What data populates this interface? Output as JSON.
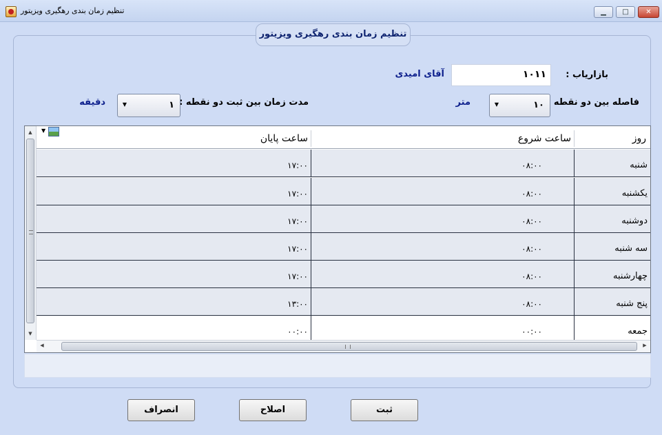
{
  "window": {
    "title": "تنظیم زمان بندی رهگیری ویزیتور",
    "minimize_glyph": "▁",
    "maximize_glyph": "□",
    "close_glyph": "✕"
  },
  "form": {
    "group_title": "تنظیم زمان بندی رهگیری ویزیتور",
    "marketer_label": "بازاریاب :",
    "marketer_code": "۱۰۱۱",
    "marketer_name": "آقای امیدی",
    "distance_label": "فاصله بین دو نقطه :",
    "distance_value": "۱۰",
    "distance_unit": "متر",
    "duration_label": "مدت زمان بین ثبت دو نقطه :",
    "duration_value": "۱",
    "duration_unit": "دقیقه"
  },
  "grid": {
    "columns": [
      "روز",
      "ساعت شروع",
      "ساعت پایان"
    ],
    "rows": [
      {
        "day": "شنبه",
        "start": "۰۸:۰۰",
        "end": "۱۷:۰۰"
      },
      {
        "day": "یکشنبه",
        "start": "۰۸:۰۰",
        "end": "۱۷:۰۰"
      },
      {
        "day": "دوشنبه",
        "start": "۰۸:۰۰",
        "end": "۱۷:۰۰"
      },
      {
        "day": "سه شنبه",
        "start": "۰۸:۰۰",
        "end": "۱۷:۰۰"
      },
      {
        "day": "چهارشنبه",
        "start": "۰۸:۰۰",
        "end": "۱۷:۰۰"
      },
      {
        "day": "پنج شنبه",
        "start": "۰۸:۰۰",
        "end": "۱۳:۰۰"
      },
      {
        "day": "جمعه",
        "start": "۰۰:۰۰",
        "end": "۰۰:۰۰"
      }
    ]
  },
  "buttons": {
    "cancel": "انصراف",
    "edit": "اصلاح",
    "save": "ثبت"
  },
  "icons": {
    "app": "app-icon",
    "combo_arrow": "▼",
    "scroll_up": "▲",
    "scroll_down": "▼",
    "scroll_left": "◀",
    "scroll_right": "▶"
  }
}
